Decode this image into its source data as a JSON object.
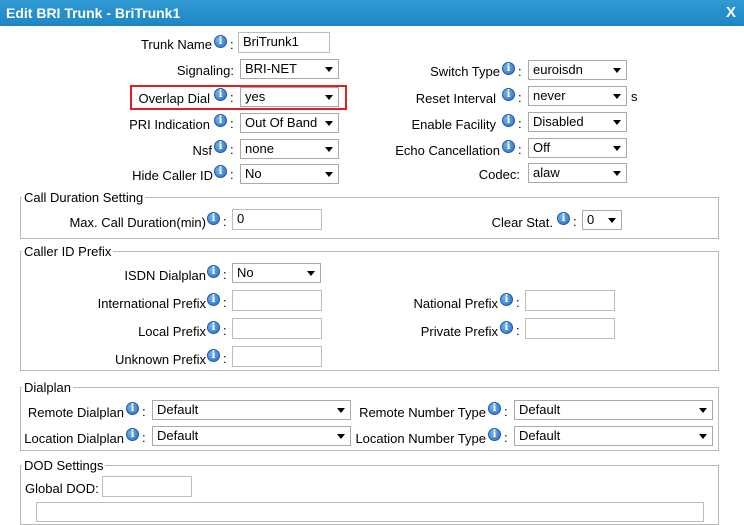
{
  "window": {
    "title": "Edit BRI Trunk - BriTrunk1",
    "close": "X"
  },
  "trunk": {
    "trunk_name_label": "Trunk Name",
    "trunk_name_value": "BriTrunk1",
    "signaling_label": "Signaling:",
    "signaling_value": "BRI-NET",
    "overlap_dial_label": "Overlap Dial",
    "overlap_dial_value": "yes",
    "pri_indication_label": "PRI Indication",
    "pri_indication_value": "Out Of Band",
    "nsf_label": "Nsf",
    "nsf_value": "none",
    "hide_caller_id_label": "Hide Caller ID",
    "hide_caller_id_value": "No",
    "switch_type_label": "Switch Type",
    "switch_type_value": "euroisdn",
    "reset_interval_label": "Reset Interval",
    "reset_interval_value": "never",
    "reset_interval_unit": "s",
    "enable_facility_label": "Enable Facility",
    "enable_facility_value": "Disabled",
    "echo_cancellation_label": "Echo Cancellation",
    "echo_cancellation_value": "Off",
    "codec_label": "Codec:",
    "codec_value": "alaw"
  },
  "call_duration": {
    "legend": "Call Duration Setting",
    "max_label": "Max. Call Duration(min)",
    "max_value": "0",
    "clear_label": "Clear Stat.",
    "clear_value": "0"
  },
  "caller_id": {
    "legend": "Caller ID Prefix",
    "isdn_label": "ISDN Dialplan",
    "isdn_value": "No",
    "international_label": "International Prefix",
    "international_value": "",
    "national_label": "National Prefix",
    "national_value": "",
    "local_label": "Local Prefix",
    "local_value": "",
    "private_label": "Private Prefix",
    "private_value": "",
    "unknown_label": "Unknown Prefix",
    "unknown_value": ""
  },
  "dialplan": {
    "legend": "Dialplan",
    "remote_dialplan_label": "Remote Dialplan",
    "remote_dialplan_value": "Default",
    "remote_number_type_label": "Remote Number Type",
    "remote_number_type_value": "Default",
    "location_dialplan_label": "Location Dialplan",
    "location_dialplan_value": "Default",
    "location_number_type_label": "Location Number Type",
    "location_number_type_value": "Default"
  },
  "dod": {
    "legend": "DOD Settings",
    "global_dod_label": "Global DOD:",
    "global_dod_value": ""
  },
  "colors": {
    "titlebar": "#1f86c3",
    "highlight": "#e02020",
    "info_icon": "#2a6fc4"
  },
  "icons": {
    "info": "info-icon",
    "dropdown": "chevron-down-icon"
  },
  "glyphs": {
    "info": "i",
    "colon": ":"
  }
}
